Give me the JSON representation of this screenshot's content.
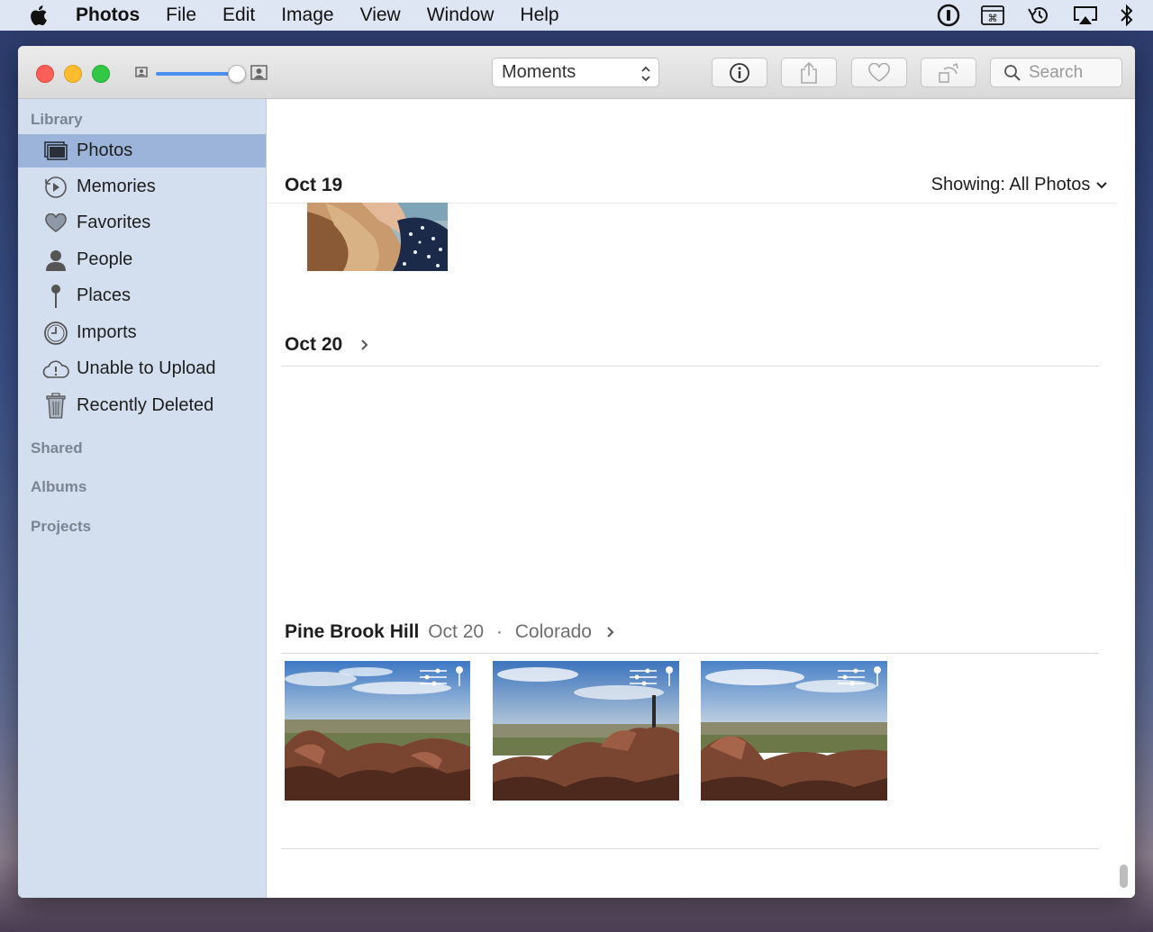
{
  "menubar": {
    "app_name": "Photos",
    "items": [
      "File",
      "Edit",
      "Image",
      "View",
      "Window",
      "Help"
    ],
    "status_icons": [
      "1password-icon",
      "keyboard-viewer-icon",
      "time-machine-icon",
      "airplay-icon",
      "bluetooth-icon"
    ]
  },
  "toolbar": {
    "view_popup": "Moments",
    "search_placeholder": "Search",
    "zoom_level": 0.9
  },
  "sidebar": {
    "library_header": "Library",
    "items": [
      {
        "label": "Photos",
        "icon": "photos-icon",
        "selected": true
      },
      {
        "label": "Memories",
        "icon": "memories-icon"
      },
      {
        "label": "Favorites",
        "icon": "heart-icon"
      },
      {
        "label": "People",
        "icon": "person-icon"
      },
      {
        "label": "Places",
        "icon": "pin-icon"
      },
      {
        "label": "Imports",
        "icon": "clock-icon"
      },
      {
        "label": "Unable to Upload",
        "icon": "cloud-alert-icon"
      },
      {
        "label": "Recently Deleted",
        "icon": "trash-icon"
      }
    ],
    "shared_header": "Shared",
    "albums_header": "Albums",
    "projects_header": "Projects"
  },
  "content": {
    "showing_label": "Showing:",
    "showing_value": "All Photos",
    "moments": [
      {
        "title": "Oct 19"
      },
      {
        "title": "Oct 20"
      },
      {
        "title": "Pine Brook Hill",
        "date": "Oct 20",
        "separator": "·",
        "location": "Colorado"
      }
    ]
  },
  "colors": {
    "sidebar_bg": "#d3deee",
    "selection": "#9cb4d9",
    "accent": "#4a90ee"
  }
}
